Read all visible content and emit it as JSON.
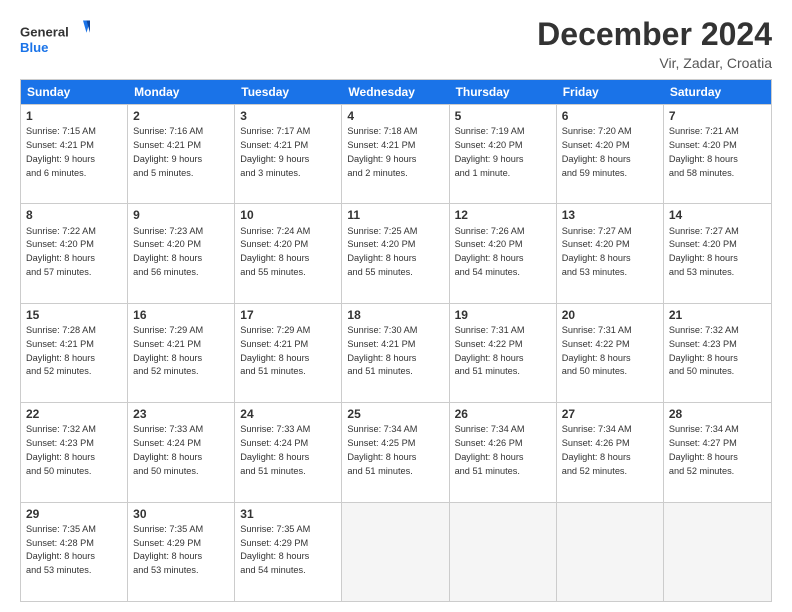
{
  "header": {
    "logo_general": "General",
    "logo_blue": "Blue",
    "month_title": "December 2024",
    "location": "Vir, Zadar, Croatia"
  },
  "days_of_week": [
    "Sunday",
    "Monday",
    "Tuesday",
    "Wednesday",
    "Thursday",
    "Friday",
    "Saturday"
  ],
  "weeks": [
    [
      {
        "day": "1",
        "info": "Sunrise: 7:15 AM\nSunset: 4:21 PM\nDaylight: 9 hours\nand 6 minutes."
      },
      {
        "day": "2",
        "info": "Sunrise: 7:16 AM\nSunset: 4:21 PM\nDaylight: 9 hours\nand 5 minutes."
      },
      {
        "day": "3",
        "info": "Sunrise: 7:17 AM\nSunset: 4:21 PM\nDaylight: 9 hours\nand 3 minutes."
      },
      {
        "day": "4",
        "info": "Sunrise: 7:18 AM\nSunset: 4:21 PM\nDaylight: 9 hours\nand 2 minutes."
      },
      {
        "day": "5",
        "info": "Sunrise: 7:19 AM\nSunset: 4:20 PM\nDaylight: 9 hours\nand 1 minute."
      },
      {
        "day": "6",
        "info": "Sunrise: 7:20 AM\nSunset: 4:20 PM\nDaylight: 8 hours\nand 59 minutes."
      },
      {
        "day": "7",
        "info": "Sunrise: 7:21 AM\nSunset: 4:20 PM\nDaylight: 8 hours\nand 58 minutes."
      }
    ],
    [
      {
        "day": "8",
        "info": "Sunrise: 7:22 AM\nSunset: 4:20 PM\nDaylight: 8 hours\nand 57 minutes."
      },
      {
        "day": "9",
        "info": "Sunrise: 7:23 AM\nSunset: 4:20 PM\nDaylight: 8 hours\nand 56 minutes."
      },
      {
        "day": "10",
        "info": "Sunrise: 7:24 AM\nSunset: 4:20 PM\nDaylight: 8 hours\nand 55 minutes."
      },
      {
        "day": "11",
        "info": "Sunrise: 7:25 AM\nSunset: 4:20 PM\nDaylight: 8 hours\nand 55 minutes."
      },
      {
        "day": "12",
        "info": "Sunrise: 7:26 AM\nSunset: 4:20 PM\nDaylight: 8 hours\nand 54 minutes."
      },
      {
        "day": "13",
        "info": "Sunrise: 7:27 AM\nSunset: 4:20 PM\nDaylight: 8 hours\nand 53 minutes."
      },
      {
        "day": "14",
        "info": "Sunrise: 7:27 AM\nSunset: 4:20 PM\nDaylight: 8 hours\nand 53 minutes."
      }
    ],
    [
      {
        "day": "15",
        "info": "Sunrise: 7:28 AM\nSunset: 4:21 PM\nDaylight: 8 hours\nand 52 minutes."
      },
      {
        "day": "16",
        "info": "Sunrise: 7:29 AM\nSunset: 4:21 PM\nDaylight: 8 hours\nand 52 minutes."
      },
      {
        "day": "17",
        "info": "Sunrise: 7:29 AM\nSunset: 4:21 PM\nDaylight: 8 hours\nand 51 minutes."
      },
      {
        "day": "18",
        "info": "Sunrise: 7:30 AM\nSunset: 4:21 PM\nDaylight: 8 hours\nand 51 minutes."
      },
      {
        "day": "19",
        "info": "Sunrise: 7:31 AM\nSunset: 4:22 PM\nDaylight: 8 hours\nand 51 minutes."
      },
      {
        "day": "20",
        "info": "Sunrise: 7:31 AM\nSunset: 4:22 PM\nDaylight: 8 hours\nand 50 minutes."
      },
      {
        "day": "21",
        "info": "Sunrise: 7:32 AM\nSunset: 4:23 PM\nDaylight: 8 hours\nand 50 minutes."
      }
    ],
    [
      {
        "day": "22",
        "info": "Sunrise: 7:32 AM\nSunset: 4:23 PM\nDaylight: 8 hours\nand 50 minutes."
      },
      {
        "day": "23",
        "info": "Sunrise: 7:33 AM\nSunset: 4:24 PM\nDaylight: 8 hours\nand 50 minutes."
      },
      {
        "day": "24",
        "info": "Sunrise: 7:33 AM\nSunset: 4:24 PM\nDaylight: 8 hours\nand 51 minutes."
      },
      {
        "day": "25",
        "info": "Sunrise: 7:34 AM\nSunset: 4:25 PM\nDaylight: 8 hours\nand 51 minutes."
      },
      {
        "day": "26",
        "info": "Sunrise: 7:34 AM\nSunset: 4:26 PM\nDaylight: 8 hours\nand 51 minutes."
      },
      {
        "day": "27",
        "info": "Sunrise: 7:34 AM\nSunset: 4:26 PM\nDaylight: 8 hours\nand 52 minutes."
      },
      {
        "day": "28",
        "info": "Sunrise: 7:34 AM\nSunset: 4:27 PM\nDaylight: 8 hours\nand 52 minutes."
      }
    ],
    [
      {
        "day": "29",
        "info": "Sunrise: 7:35 AM\nSunset: 4:28 PM\nDaylight: 8 hours\nand 53 minutes."
      },
      {
        "day": "30",
        "info": "Sunrise: 7:35 AM\nSunset: 4:29 PM\nDaylight: 8 hours\nand 53 minutes."
      },
      {
        "day": "31",
        "info": "Sunrise: 7:35 AM\nSunset: 4:29 PM\nDaylight: 8 hours\nand 54 minutes."
      },
      {
        "day": "",
        "info": ""
      },
      {
        "day": "",
        "info": ""
      },
      {
        "day": "",
        "info": ""
      },
      {
        "day": "",
        "info": ""
      }
    ]
  ]
}
